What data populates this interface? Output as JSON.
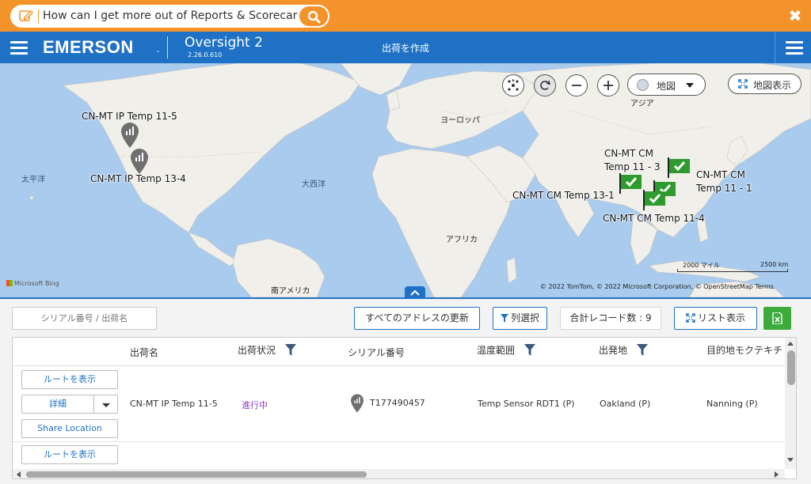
{
  "helpbar": {
    "question": "How can I get more out of Reports & Scorecards?",
    "close": "✖",
    "color": "#f5932b"
  },
  "header": {
    "logo": "EMERSON",
    "logo_tm": "™",
    "app_name": "Oversight 2",
    "version": "2.26.0.610",
    "title": "出荷を作成",
    "color": "#1e71c5"
  },
  "map": {
    "controls": {
      "map_type": "地図",
      "fullscreen": "地図表示"
    },
    "labels": {
      "asia": "アジア",
      "europe": "ヨーロッパ",
      "africa": "アフリカ",
      "south_america": "南アメリカ",
      "pacific": "太平洋",
      "atlantic": "大西洋"
    },
    "markers": [
      {
        "label": "CN-MT IP Temp 11-5",
        "icon": "gray-sensor-pin"
      },
      {
        "label": "CN-MT IP Temp 13-4",
        "icon": "gray-sensor-pin"
      },
      {
        "label": "CN-MT CM\nTemp 11 - 3",
        "icon": "green-check-flag"
      },
      {
        "label": "CN-MT CM\nTemp 11 - 1",
        "icon": "green-check-flag"
      },
      {
        "label": "CN-MT CM Temp 13-1",
        "icon": "green-check-flag"
      },
      {
        "label": "CN-MT CM Temp 11-4",
        "icon": "green-check-flag"
      }
    ],
    "scale_left": "2000 マイル",
    "scale_right": "2500 km",
    "bing": "Microsoft Bing",
    "copyright": "© 2022 TomTom, © 2022 Microsoft Corporation, © OpenStreetMap   Terms"
  },
  "toolbar": {
    "search_placeholder": "シリアル番号 / 出荷名",
    "update_all": "すべてのアドレスの更新",
    "column_select": "列選択",
    "record_count_label": "合計レコード数 : 9",
    "list_view": "リスト表示"
  },
  "table": {
    "columns": [
      "出荷名",
      "出荷状況",
      "シリアル番号",
      "温度範囲",
      "出発地",
      "目的地モクテキチ"
    ],
    "filterable": [
      false,
      true,
      false,
      true,
      true,
      false
    ],
    "rows": [
      {
        "route_button": "ルートを表示",
        "detail_button": "詳細",
        "share_button": "Share Location",
        "name": "CN-MT IP Temp 11-5",
        "status": "進行中",
        "serial": "T177490457",
        "temp_range": "Temp Sensor RDT1 (P)",
        "origin": "Oakland (P)",
        "destination": "Nanning (P)"
      },
      {
        "route_button": "ルートを表示"
      }
    ]
  }
}
